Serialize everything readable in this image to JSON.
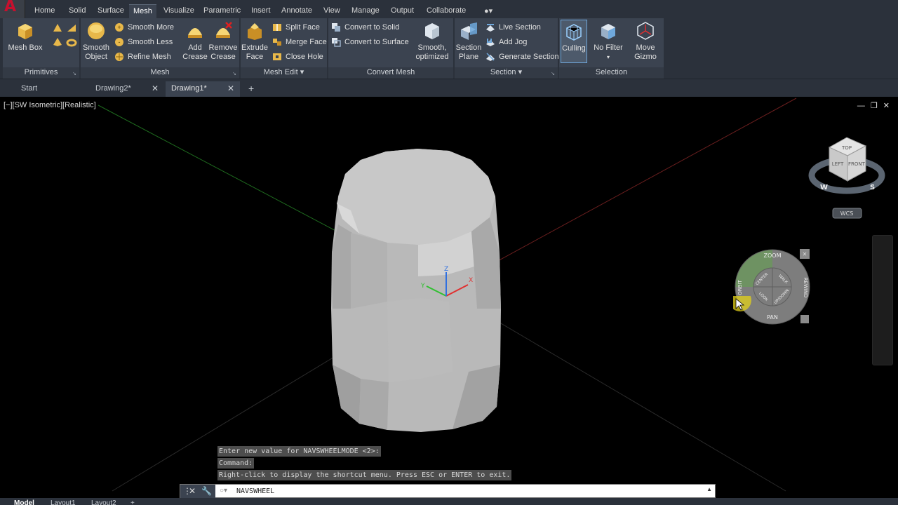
{
  "menu": {
    "tabs": [
      "Home",
      "Solid",
      "Surface",
      "Mesh",
      "Visualize",
      "Parametric",
      "Insert",
      "Annotate",
      "View",
      "Manage",
      "Output",
      "Collaborate"
    ],
    "active": "Mesh"
  },
  "ribbon": {
    "primitives": {
      "title": "Primitives",
      "mesh_box": "Mesh Box"
    },
    "mesh": {
      "title": "Mesh",
      "smooth_object_1": "Smooth",
      "smooth_object_2": "Object",
      "smooth_more": "Smooth More",
      "smooth_less": "Smooth Less",
      "refine_mesh": "Refine Mesh",
      "add_crease_1": "Add",
      "add_crease_2": "Crease",
      "remove_crease_1": "Remove",
      "remove_crease_2": "Crease"
    },
    "mesh_edit": {
      "title": "Mesh Edit",
      "extrude_face_1": "Extrude",
      "extrude_face_2": "Face",
      "split_face": "Split Face",
      "merge_face": "Merge Face",
      "close_hole": "Close Hole"
    },
    "convert_mesh": {
      "title": "Convert Mesh",
      "convert_to_solid": "Convert to Solid",
      "convert_to_surface": "Convert to Surface",
      "smooth_optimized_1": "Smooth,",
      "smooth_optimized_2": "optimized"
    },
    "section": {
      "title": "Section",
      "section_plane_1": "Section",
      "section_plane_2": "Plane",
      "live_section": "Live Section",
      "add_jog": "Add Jog",
      "generate_section": "Generate Section"
    },
    "selection": {
      "title": "Selection",
      "culling": "Culling",
      "no_filter": "No Filter",
      "move_gizmo_1": "Move",
      "move_gizmo_2": "Gizmo"
    }
  },
  "doc_tabs": [
    {
      "label": "Start"
    },
    {
      "label": "Drawing2*"
    },
    {
      "label": "Drawing1*"
    }
  ],
  "viewport": {
    "label": "[−][SW Isometric][Realistic]",
    "viewcube": {
      "top": "TOP",
      "left": "LEFT",
      "front": "FRONT",
      "compass_w": "W",
      "compass_s": "S",
      "wcs": "WCS"
    },
    "navwheel": {
      "zoom": "ZOOM",
      "rewind": "REWIND",
      "pan": "PAN",
      "orbit": "ORBIT",
      "center": "CENTER",
      "walk": "WALK",
      "look": "LOOK",
      "updown": "UP/DOWN"
    }
  },
  "command": {
    "history": [
      "Enter new value for NAVSWHEELMODE <2>:",
      "Command:",
      "Right-click to display the shortcut menu. Press ESC or ENTER to exit."
    ],
    "input_value": "NAVSWHEEL"
  },
  "layout_tabs": [
    "Model",
    "Layout1",
    "Layout2"
  ],
  "colors": {
    "ribbon_bg": "#3b4350",
    "chrome_bg": "#2b313b",
    "accent": "#4a90d9",
    "axis_x": "#e03030",
    "axis_y": "#30c030",
    "axis_z": "#3070e0"
  }
}
